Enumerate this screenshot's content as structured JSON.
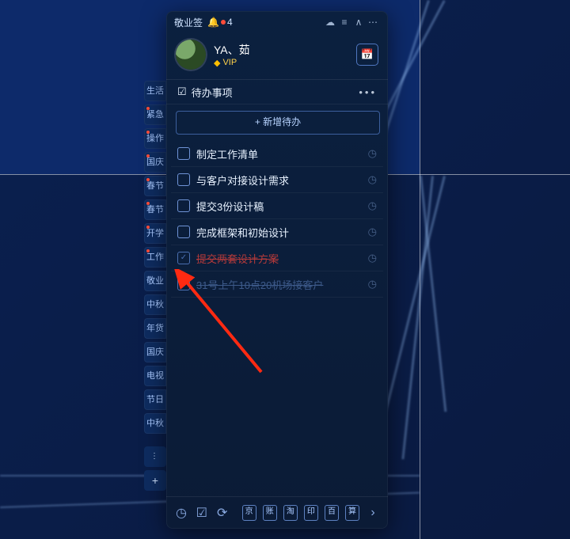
{
  "app": {
    "title": "敬业签",
    "notification_count": "4"
  },
  "titlebar_icons": {
    "cloud": "☁",
    "menu": "≡",
    "collapse": "∧",
    "more": "⋯"
  },
  "profile": {
    "name": "YA、茹",
    "vip_label": "VIP"
  },
  "header": {
    "title": "待办事项",
    "more": "•••"
  },
  "add_button_label": "+ 新增待办",
  "tasks": [
    {
      "text": "制定工作清单",
      "done": false
    },
    {
      "text": "与客户对接设计需求",
      "done": false
    },
    {
      "text": "提交3份设计稿",
      "done": false
    },
    {
      "text": "完成框架和初始设计",
      "done": false
    },
    {
      "text": "提交两套设计方案",
      "done": true,
      "red": true
    },
    {
      "text": "31号上午10点20机场接客户",
      "done": true
    }
  ],
  "ribbon": [
    {
      "label": "生活",
      "dot": false
    },
    {
      "label": "紧急",
      "dot": true
    },
    {
      "label": "操作",
      "dot": true
    },
    {
      "label": "国庆",
      "dot": true
    },
    {
      "label": "春节",
      "dot": true
    },
    {
      "label": "春节",
      "dot": true
    },
    {
      "label": "开学",
      "dot": true
    },
    {
      "label": "工作",
      "dot": true
    },
    {
      "label": "敬业",
      "dot": false
    },
    {
      "label": "中秋",
      "dot": false
    },
    {
      "label": "年货",
      "dot": false
    },
    {
      "label": "国庆",
      "dot": false
    },
    {
      "label": "电视",
      "dot": false
    },
    {
      "label": "节日",
      "dot": false
    },
    {
      "label": "中秋",
      "dot": false
    }
  ],
  "ribbon_more": "⋮",
  "ribbon_plus": "+",
  "bottom": {
    "clock": "◷",
    "todo": "☑",
    "refresh": "⟳",
    "sq1": "京",
    "sq2": "账",
    "sq3": "淘",
    "sq4": "印",
    "sq5": "百",
    "sq6": "算",
    "end": "›"
  }
}
